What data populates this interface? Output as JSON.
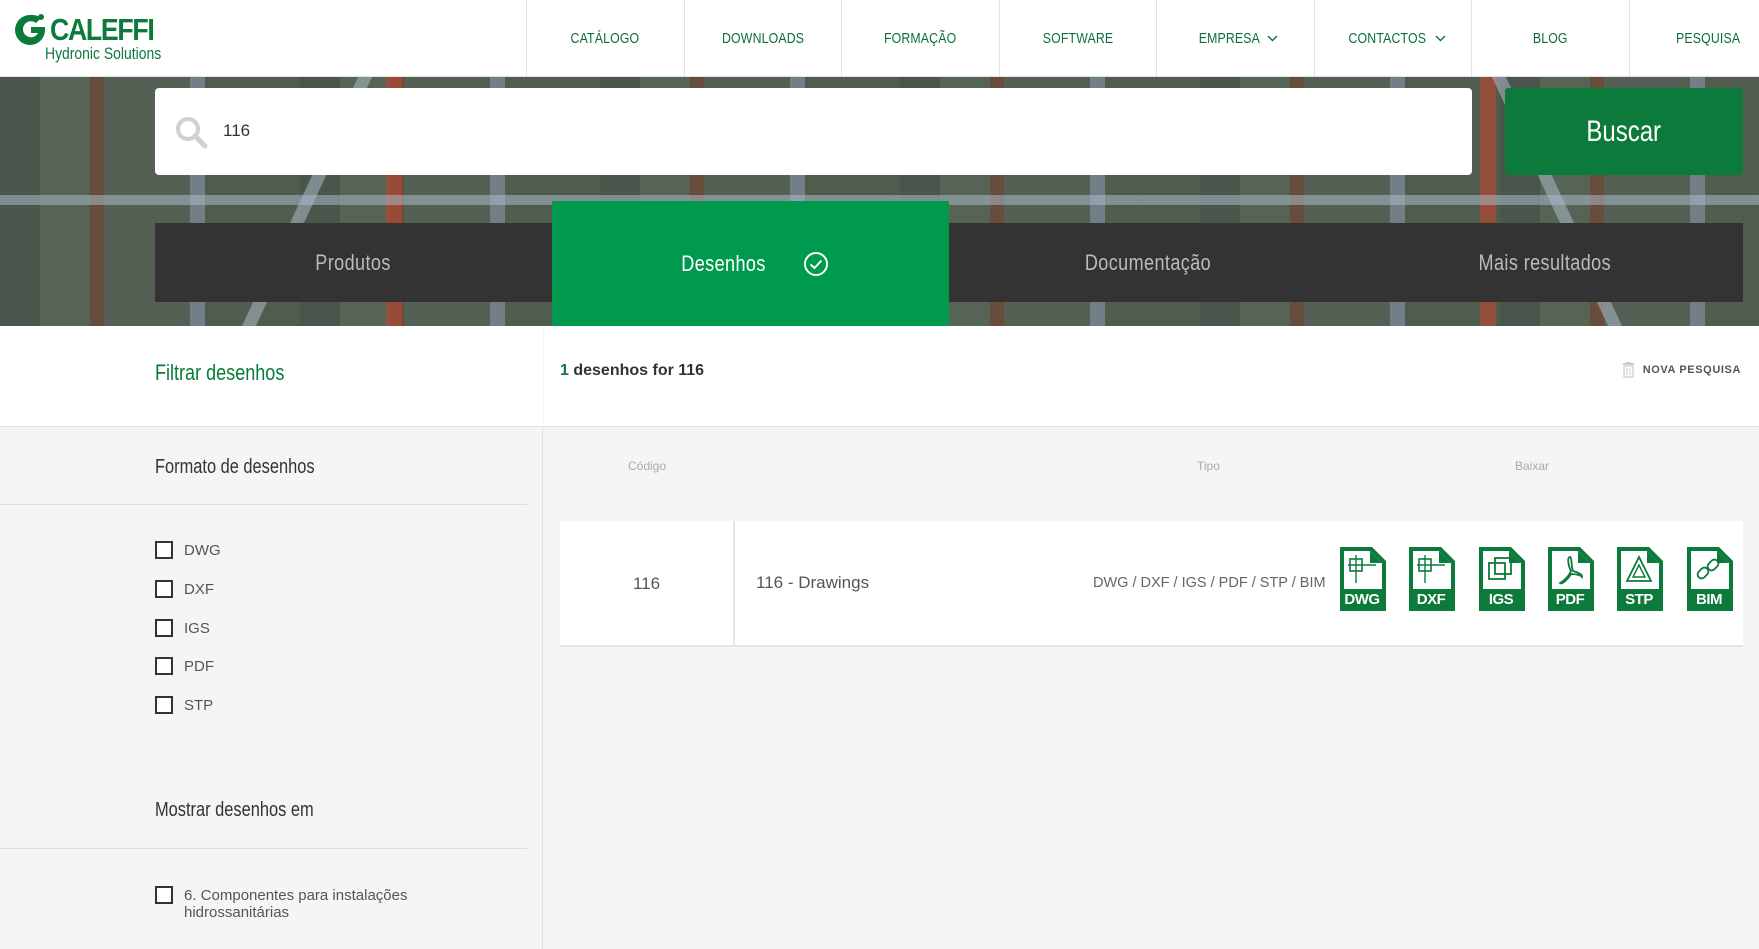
{
  "brand": {
    "name": "CALEFFI",
    "tagline": "Hydronic Solutions"
  },
  "nav": [
    {
      "label": "CATÁLOGO",
      "has_dropdown": false
    },
    {
      "label": "DOWNLOADS",
      "has_dropdown": false
    },
    {
      "label": "FORMAÇÃO",
      "has_dropdown": false
    },
    {
      "label": "SOFTWARE",
      "has_dropdown": false
    },
    {
      "label": "EMPRESA",
      "has_dropdown": true
    },
    {
      "label": "CONTACTOS",
      "has_dropdown": true
    },
    {
      "label": "BLOG",
      "has_dropdown": false
    },
    {
      "label": "PESQUISA",
      "has_dropdown": false
    }
  ],
  "search": {
    "value": "116",
    "button_label": "Buscar",
    "icon": "search-icon"
  },
  "tabs": [
    {
      "label": "Produtos",
      "active": false
    },
    {
      "label": "Desenhos",
      "active": true,
      "icon": "check-circle-icon"
    },
    {
      "label": "Documentação",
      "active": false
    },
    {
      "label": "Mais resultados",
      "active": false
    }
  ],
  "sidebar": {
    "title": "Filtrar desenhos",
    "format_group": {
      "title": "Formato de desenhos",
      "options": [
        {
          "label": "DWG",
          "checked": false
        },
        {
          "label": "DXF",
          "checked": false
        },
        {
          "label": "IGS",
          "checked": false
        },
        {
          "label": "PDF",
          "checked": false
        },
        {
          "label": "STP",
          "checked": false
        }
      ]
    },
    "show_group": {
      "title": "Mostrar desenhos em",
      "options": [
        {
          "label": "6. Componentes para instalações hidrossanitárias",
          "checked": false
        }
      ]
    }
  },
  "results": {
    "count": "1",
    "count_text": " desenhos for 116",
    "new_search_label": "NOVA PESQUISA",
    "columns": {
      "code": "Código",
      "type": "Tipo",
      "download": "Baixar"
    },
    "rows": [
      {
        "code": "116",
        "name": "116 - Drawings",
        "types": "DWG / DXF / IGS / PDF / STP / BIM",
        "downloads": [
          "DWG",
          "DXF",
          "IGS",
          "PDF",
          "STP",
          "BIM"
        ]
      }
    ]
  },
  "colors": {
    "brand_green": "#0b7a3a",
    "active_tab": "#009a4e",
    "tab_bg": "#333333"
  }
}
